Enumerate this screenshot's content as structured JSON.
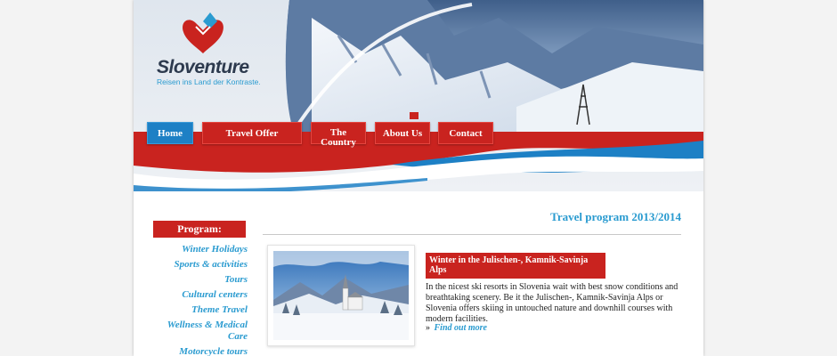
{
  "brand": {
    "name": "Sloventure",
    "tagline": "Reisen ins Land der Kontraste."
  },
  "nav": {
    "items": [
      {
        "label": "Home",
        "active": true
      },
      {
        "label": "Travel Offer",
        "active": false
      },
      {
        "label": "The Country",
        "active": false
      },
      {
        "label": "About Us",
        "active": false
      },
      {
        "label": "Contact",
        "active": false
      }
    ]
  },
  "sidebar": {
    "heading": "Program:",
    "items": [
      {
        "label": "Winter Holidays"
      },
      {
        "label": "Sports & activities"
      },
      {
        "label": "Tours"
      },
      {
        "label": "Cultural centers"
      },
      {
        "label": "Theme Travel"
      },
      {
        "label": "Wellness & Medical Care"
      },
      {
        "label": "Motorcycle tours"
      }
    ]
  },
  "main": {
    "title": "Travel program 2013/2014",
    "offer": {
      "heading": "Winter in the Julischen-, Kamnik-Savinja Alps",
      "text": "In the nicest ski resorts in Slovenia wait with best snow conditions and breathtaking scenery. Be it the Julischen-, Kamnik-Savinja Alps or Slovenia offers skiing in untouched nature and downhill courses with modern facilities.",
      "link": "Find out more",
      "link_marker": "»"
    }
  },
  "colors": {
    "red": "#c9231f",
    "blue": "#1d80c5",
    "link_blue": "#2a9bd0",
    "dark": "#2d3a4e"
  }
}
